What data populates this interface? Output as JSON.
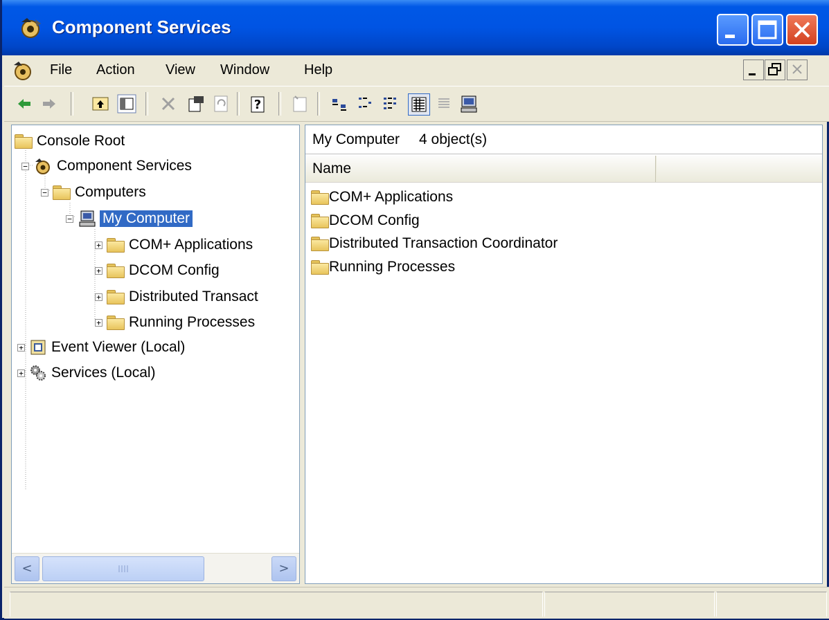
{
  "window": {
    "title": "Component Services",
    "accent": "#0054e3",
    "selection_color": "#316ac5"
  },
  "caption_buttons": [
    "minimize-icon",
    "maximize-icon",
    "close-icon"
  ],
  "menubar": {
    "items": [
      "File",
      "Action",
      "View",
      "Window",
      "Help"
    ]
  },
  "toolbar": {
    "buttons": [
      "back-arrow-icon",
      "forward-arrow-icon",
      "up-one-level-icon",
      "show-hide-tree-icon",
      "delete-icon",
      "properties-icon",
      "refresh-icon",
      "help-icon",
      "new-window-icon",
      "large-icons-icon",
      "small-icons-icon",
      "list-view-icon",
      "detail-view-icon",
      "status-view-icon",
      "computer-icon"
    ]
  },
  "tree": {
    "root": "Console Root",
    "items": [
      {
        "label": "Component Services",
        "icon": "component-services-icon"
      },
      {
        "label": "Computers",
        "icon": "folder-icon"
      },
      {
        "label": "My Computer",
        "icon": "computer-icon"
      },
      {
        "label": "COM+ Applications",
        "icon": "folder-icon"
      },
      {
        "label": "DCOM Config",
        "icon": "folder-icon"
      },
      {
        "label": "Distributed Transact",
        "icon": "folder-icon"
      },
      {
        "label": "Running Processes",
        "icon": "folder-icon"
      },
      {
        "label": "Event Viewer (Local)",
        "icon": "event-viewer-icon"
      },
      {
        "label": "Services (Local)",
        "icon": "services-gears-icon"
      }
    ]
  },
  "right_pane": {
    "location": "My Computer",
    "count": "4 object(s)",
    "column_header": "Name",
    "items": [
      "COM+ Applications",
      "DCOM Config",
      "Distributed Transaction Coordinator",
      "Running Processes"
    ]
  },
  "scrollbar": {
    "left_arrow": "<",
    "right_arrow": ">"
  }
}
